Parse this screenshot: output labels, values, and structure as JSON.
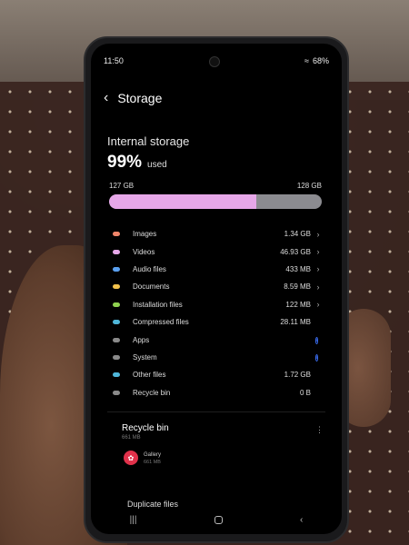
{
  "status": {
    "time": "11:50",
    "battery": "68%"
  },
  "header": {
    "title": "Storage"
  },
  "storage": {
    "label": "Internal storage",
    "percent": "99%",
    "used_text": "used",
    "used_capacity": "127 GB",
    "total_capacity": "128 GB",
    "used_fraction": 0.99,
    "used_color": "#e6a7e8"
  },
  "categories": [
    {
      "name": "Images",
      "size": "1.34 GB",
      "color": "#f0856a",
      "action": "chevron"
    },
    {
      "name": "Videos",
      "size": "46.93 GB",
      "color": "#e6a7e8",
      "action": "chevron"
    },
    {
      "name": "Audio files",
      "size": "433 MB",
      "color": "#5aa0f0",
      "action": "chevron"
    },
    {
      "name": "Documents",
      "size": "8.59 MB",
      "color": "#f2c24b",
      "action": "chevron"
    },
    {
      "name": "Installation files",
      "size": "122 MB",
      "color": "#8fd14f",
      "action": "chevron"
    },
    {
      "name": "Compressed files",
      "size": "28.11 MB",
      "color": "#4fb6d9",
      "action": "none"
    },
    {
      "name": "Apps",
      "size": "",
      "color": "#8a8a8a",
      "action": "info"
    },
    {
      "name": "System",
      "size": "",
      "color": "#8a8a8a",
      "action": "info"
    },
    {
      "name": "Other files",
      "size": "1.72 GB",
      "color": "#4fb6d9",
      "action": "none"
    },
    {
      "name": "Recycle bin",
      "size": "0 B",
      "color": "#8a8a8a",
      "action": "none"
    }
  ],
  "recycle": {
    "title": "Recycle bin",
    "size": "661 MB",
    "app_name": "Gallery",
    "app_size": "661 MB"
  },
  "duplicates": {
    "title": "Duplicate files"
  }
}
